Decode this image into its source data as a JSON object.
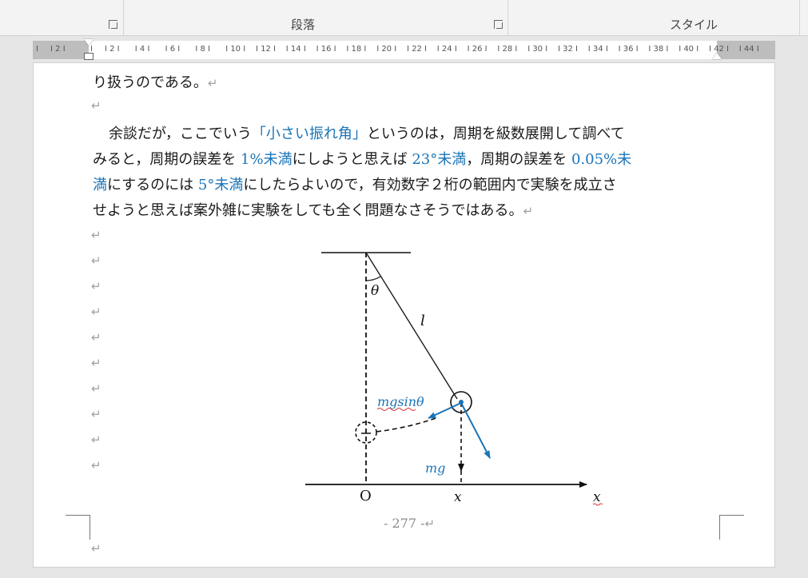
{
  "ribbon": {
    "paragraph_label": "段落",
    "style_label": "スタイル"
  },
  "ruler": {
    "left_labels": [
      "2"
    ],
    "labels": [
      "2",
      "4",
      "6",
      "8",
      "10",
      "12",
      "14",
      "16",
      "18",
      "20",
      "22",
      "24",
      "26",
      "28",
      "30",
      "32",
      "34",
      "36",
      "38",
      "40",
      "42",
      "44"
    ]
  },
  "document": {
    "line0": "り扱うのである。",
    "p1_l1_a": "余談だが，ここでいう",
    "p1_l1_b": "「小さい振れ角」",
    "p1_l1_c": "というのは，周期を級数展開して調べて",
    "p1_l2_a": "みると，周期の誤差を ",
    "p1_l2_b": "1%未満",
    "p1_l2_c": "にしようと思えば ",
    "p1_l2_d": "23°未満",
    "p1_l2_e": "，周期の誤差を ",
    "p1_l2_f": "0.05%未",
    "p1_l3_a": "満",
    "p1_l3_b": "にするのには ",
    "p1_l3_c": "5°未満",
    "p1_l3_d": "にしたらよいので，有効数字２桁の範囲内で実験を成立さ",
    "p1_l4": "せようと思えば案外雑に実験をしても全く問題なさそうではある。",
    "para_mark": "↵",
    "page_number": "- 277 -"
  },
  "figure": {
    "theta": "θ",
    "length": "l",
    "tangential_force": "mgsinθ",
    "weight": "mg",
    "origin": "O",
    "x_pos": "x",
    "x_axis": "x"
  },
  "colors": {
    "accent_blue": "#1a74b8",
    "text": "#1a1a1a",
    "formatting_mark": "#a0a0a0"
  }
}
